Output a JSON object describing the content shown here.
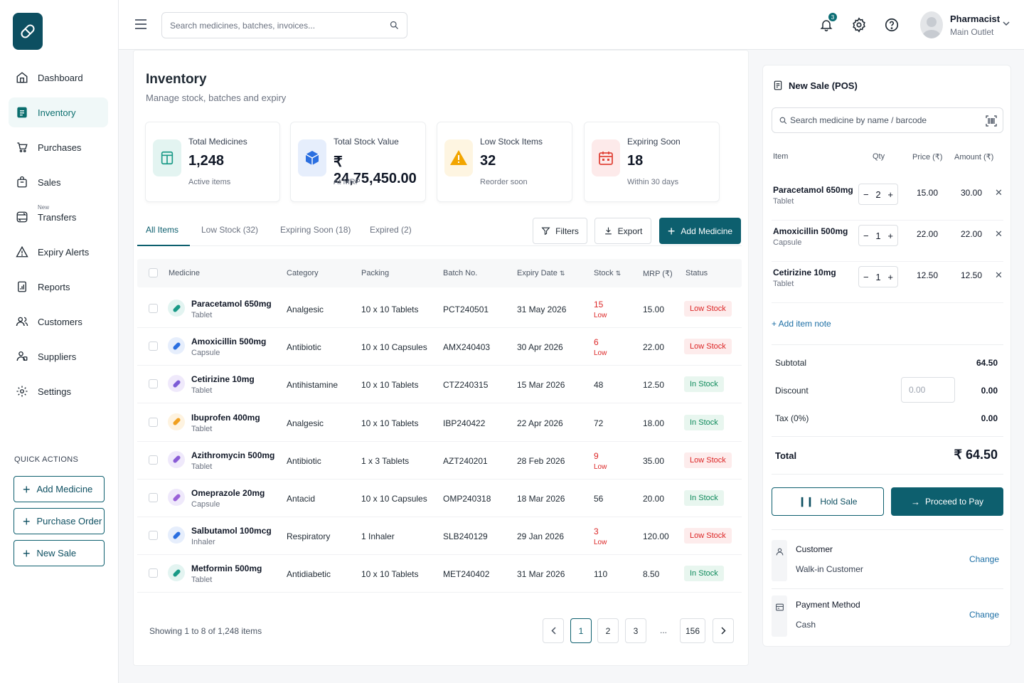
{
  "sidebar": {
    "items": [
      {
        "label": "Dashboard",
        "icon": "home-icon"
      },
      {
        "label": "Inventory",
        "icon": "inventory-icon",
        "active": true
      },
      {
        "label": "Purchases",
        "icon": "cart-icon"
      },
      {
        "label": "Sales",
        "icon": "bag-icon"
      },
      {
        "label": "Transfers",
        "icon": "transfer-icon",
        "badge": "New"
      },
      {
        "label": "Expiry Alerts",
        "icon": "alert-icon"
      },
      {
        "label": "Reports",
        "icon": "report-icon"
      },
      {
        "label": "Customers",
        "icon": "customers-icon"
      },
      {
        "label": "Suppliers",
        "icon": "suppliers-icon"
      },
      {
        "label": "Settings",
        "icon": "gear-icon"
      }
    ],
    "quick_actions_title": "QUICK ACTIONS",
    "quick_actions": [
      "Add Medicine",
      "Purchase Order",
      "New Sale"
    ]
  },
  "header": {
    "search_placeholder": "Search medicines, batches, invoices...",
    "notification_count": "3",
    "user_name": "Pharmacist",
    "user_role": "Main Outlet"
  },
  "page": {
    "title": "Inventory",
    "subtitle": "Manage stock, batches and expiry"
  },
  "stats": [
    {
      "label": "Total Medicines",
      "value": "1,248",
      "sub": "Active items"
    },
    {
      "label": "Total Stock Value",
      "value": "₹ 24,75,450.00",
      "sub": "At MRP"
    },
    {
      "label": "Low Stock Items",
      "value": "32",
      "sub": "Reorder soon"
    },
    {
      "label": "Expiring Soon",
      "value": "18",
      "sub": "Within 30 days"
    }
  ],
  "tabs": [
    "All Items",
    "Low Stock (32)",
    "Expiring Soon (18)",
    "Expired (2)"
  ],
  "actions": {
    "filters": "Filters",
    "export": "Export",
    "add": "Add Medicine"
  },
  "table": {
    "columns": [
      "Medicine",
      "Category",
      "Packing",
      "Batch No.",
      "Expiry Date",
      "Stock",
      "MRP (₹)",
      "Status"
    ],
    "rows": [
      {
        "name": "Paracetamol 650mg",
        "form": "Tablet",
        "category": "Analgesic",
        "packing": "10 x 10 Tablets",
        "batch": "PCT240501",
        "expiry": "31 May 2026",
        "stock": "15",
        "stock_note": "Low",
        "mrp": "15.00",
        "status": "Low Stock"
      },
      {
        "name": "Amoxicillin 500mg",
        "form": "Capsule",
        "category": "Antibiotic",
        "packing": "10 x 10 Capsules",
        "batch": "AMX240403",
        "expiry": "30 Apr 2026",
        "stock": "6",
        "stock_note": "Low",
        "mrp": "22.00",
        "status": "Low Stock"
      },
      {
        "name": "Cetirizine 10mg",
        "form": "Tablet",
        "category": "Antihistamine",
        "packing": "10 x 10 Tablets",
        "batch": "CTZ240315",
        "expiry": "15 Mar 2026",
        "stock": "48",
        "stock_note": "",
        "mrp": "12.50",
        "status": "In Stock"
      },
      {
        "name": "Ibuprofen 400mg",
        "form": "Tablet",
        "category": "Analgesic",
        "packing": "10 x 10 Tablets",
        "batch": "IBP240422",
        "expiry": "22 Apr 2026",
        "stock": "72",
        "stock_note": "",
        "mrp": "18.00",
        "status": "In Stock"
      },
      {
        "name": "Azithromycin 500mg",
        "form": "Tablet",
        "category": "Antibiotic",
        "packing": "1 x 3 Tablets",
        "batch": "AZT240201",
        "expiry": "28 Feb 2026",
        "stock": "9",
        "stock_note": "Low",
        "mrp": "35.00",
        "status": "Low Stock"
      },
      {
        "name": "Omeprazole 20mg",
        "form": "Capsule",
        "category": "Antacid",
        "packing": "10 x 10 Capsules",
        "batch": "OMP240318",
        "expiry": "18 Mar 2026",
        "stock": "56",
        "stock_note": "",
        "mrp": "20.00",
        "status": "In Stock"
      },
      {
        "name": "Salbutamol 100mcg",
        "form": "Inhaler",
        "category": "Respiratory",
        "packing": "1 Inhaler",
        "batch": "SLB240129",
        "expiry": "29 Jan 2026",
        "stock": "3",
        "stock_note": "Low",
        "mrp": "120.00",
        "status": "Low Stock"
      },
      {
        "name": "Metformin 500mg",
        "form": "Tablet",
        "category": "Antidiabetic",
        "packing": "10 x 10 Tablets",
        "batch": "MET240402",
        "expiry": "31 Mar 2026",
        "stock": "110",
        "stock_note": "",
        "mrp": "8.50",
        "status": "In Stock"
      }
    ]
  },
  "pagination": {
    "showing": "Showing 1 to 8 of 1,248 items",
    "pages": [
      "1",
      "2",
      "3"
    ],
    "dots": "...",
    "last": "156"
  },
  "pos": {
    "title": "New Sale (POS)",
    "search_placeholder": "Search medicine by name / barcode",
    "columns": [
      "Item",
      "Qty",
      "Price (₹)",
      "Amount (₹)"
    ],
    "items": [
      {
        "name": "Paracetamol 650mg",
        "form": "Tablet",
        "qty": "2",
        "price": "15.00",
        "amount": "30.00"
      },
      {
        "name": "Amoxicillin 500mg",
        "form": "Capsule",
        "qty": "1",
        "price": "22.00",
        "amount": "22.00"
      },
      {
        "name": "Cetirizine 10mg",
        "form": "Tablet",
        "qty": "1",
        "price": "12.50",
        "amount": "12.50"
      }
    ],
    "add_note": "+ Add item note",
    "subtotal_label": "Subtotal",
    "subtotal": "64.50",
    "discount_label": "Discount",
    "discount_input": "0.00",
    "discount": "0.00",
    "tax_label": "Tax (0%)",
    "tax": "0.00",
    "total_label": "Total",
    "total": "₹ 64.50",
    "hold": "Hold Sale",
    "proceed": "Proceed to Pay",
    "customer_label": "Customer",
    "customer_value": "Walk-in Customer",
    "payment_label": "Payment Method",
    "payment_value": "Cash",
    "change": "Change"
  },
  "colors": {
    "primary": "#0d5f6e",
    "danger": "#dc2626",
    "success": "#0e8a5b",
    "link": "#1d6fa5"
  }
}
